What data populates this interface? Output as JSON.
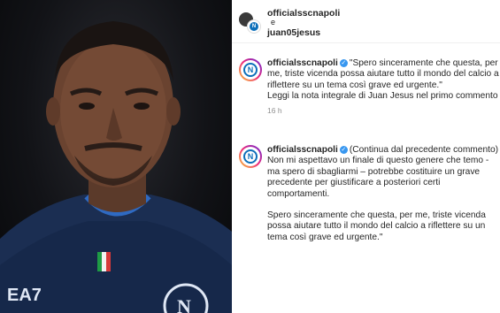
{
  "header": {
    "user1": "officialsscnapoli",
    "conjunction": "e",
    "user2": "juan05jesus"
  },
  "comments": [
    {
      "username": "officialsscnapoli",
      "text": "\"Spero sinceramente che questa, per me, triste vicenda possa aiutare tutto il mondo del calcio a riflettere su un tema così grave ed urgente.\"",
      "text2": "Leggi la nota integrale di Juan Jesus nel primo commento",
      "time": "16 h"
    },
    {
      "username": "officialsscnapoli",
      "text": "(Continua dal precedente commento) Non mi aspettavo un finale di questo genere che temo - ma spero di sbagliarmi – potrebbe costituire un grave precedente per giustificare a posteriori certi comportamenti.",
      "text2": "Spero sinceramente che questa, per me, triste vicenda possa aiutare tutto il mondo del calcio a riflettere su un tema così grave ed urgente.\""
    }
  ],
  "photo": {
    "jersey_sponsor": "EA7"
  },
  "colors": {
    "verified": "#3897f0",
    "napoli_blue": "#0c6fba",
    "timestamp": "#8e8e8e"
  }
}
